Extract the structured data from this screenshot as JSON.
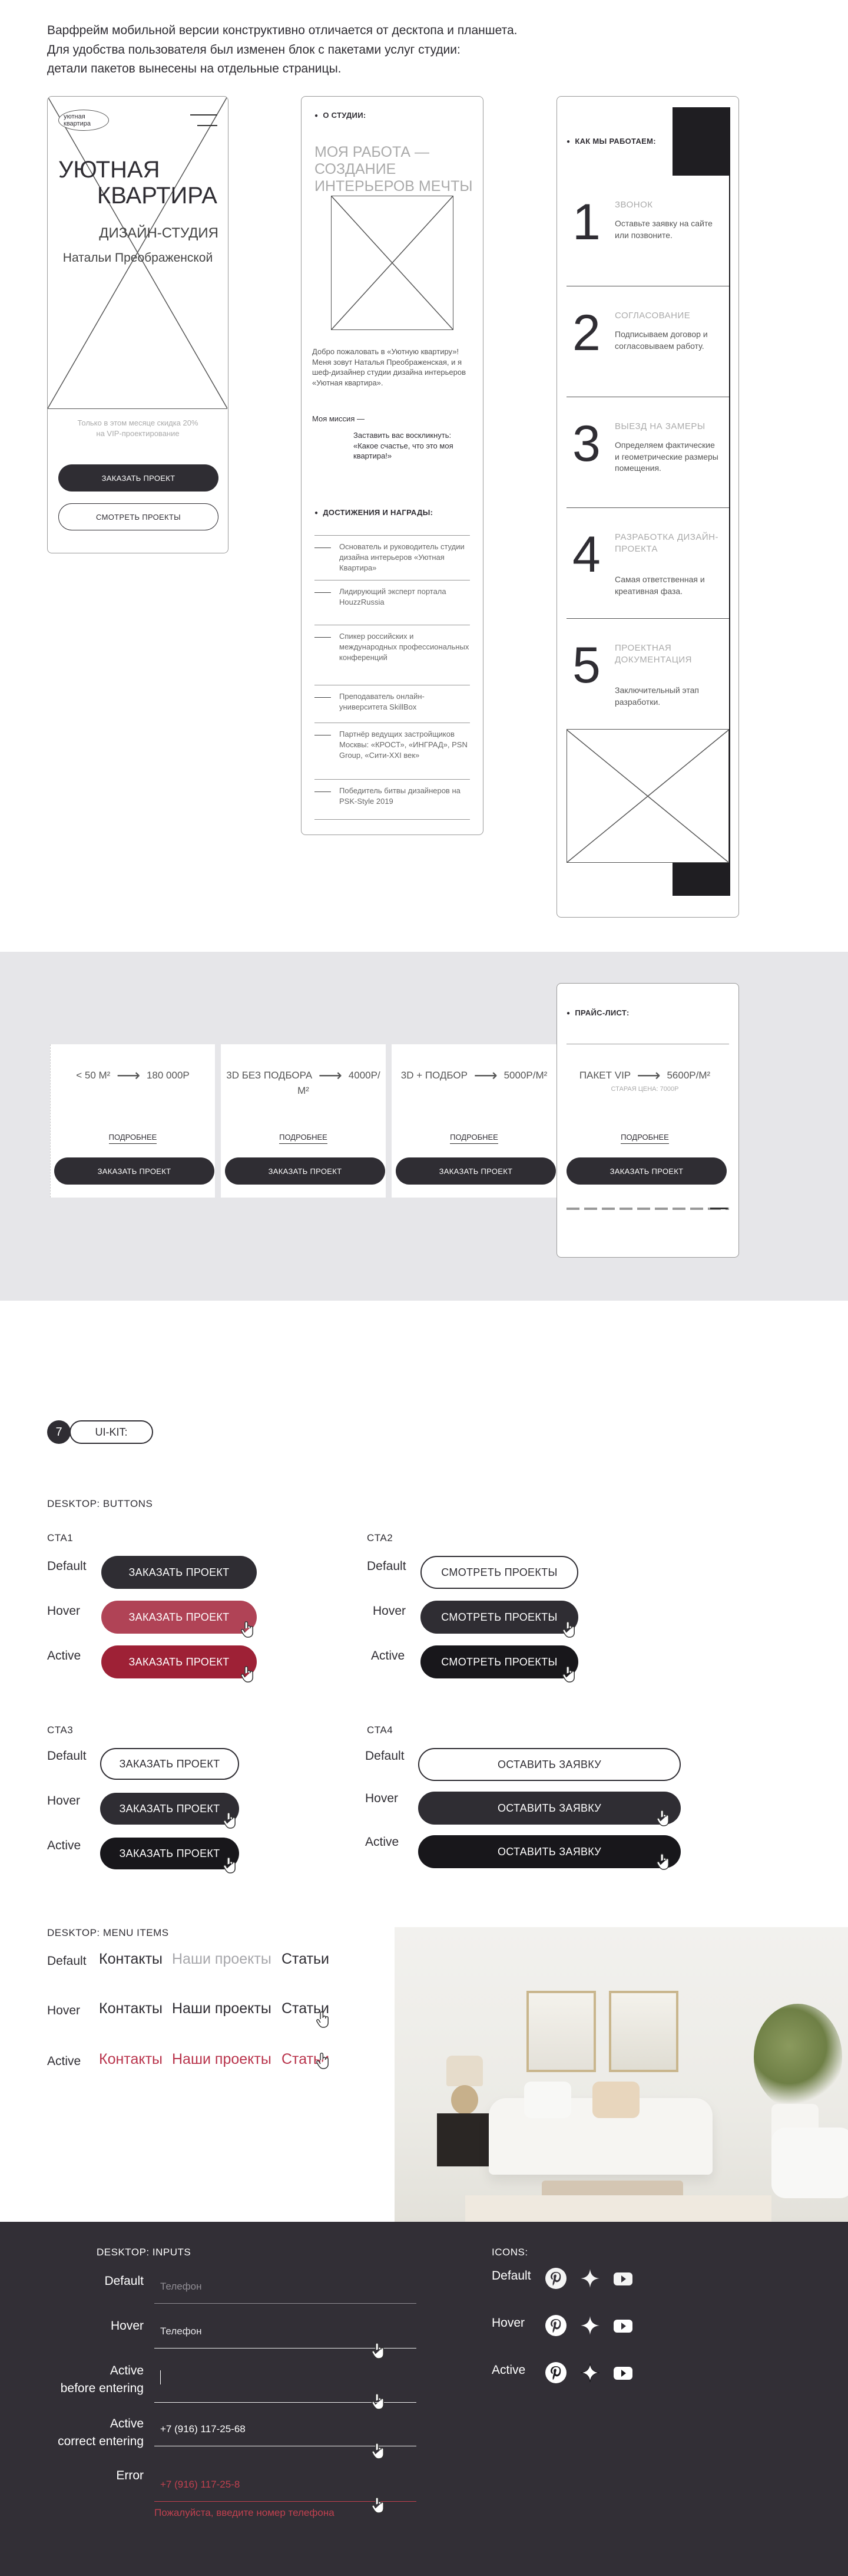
{
  "intro": {
    "line1": "Варфрейм мобильной версии конструктивно отличается от десктопа и планшета.",
    "line2": "Для удобства пользователя был изменен блок с пакетами услуг студии:",
    "line3": "детали пакетов вынесены на отдельные страницы."
  },
  "phone1": {
    "logo_line1": "уютная",
    "logo_line2": "квартира",
    "title_line1": "УЮТНАЯ",
    "title_line2": "КВАРТИРА",
    "sub1": "ДИЗАЙН-СТУДИЯ",
    "sub2": "Натальи Преображенской",
    "promo1": "Только в этом месяце скидка 20%",
    "promo2": "на VIP-проектирование",
    "btn_order": "ЗАКАЗАТЬ ПРОЕКТ",
    "btn_view": "СМОТРЕТЬ ПРОЕКТЫ"
  },
  "phone2": {
    "about_label": "О СТУДИИ:",
    "heading1": "МОЯ РАБОТА —",
    "heading2": "СОЗДАНИЕ",
    "heading3": "ИНТЕРЬЕРОВ МЕЧТЫ",
    "para": "Добро пожаловать в «Уютную квартиру»! Меня зовут Наталья Преображенская, и я шеф-дизайнер студии дизайна интерьеров «Уютная квартира».",
    "mission_label": "Моя миссия —",
    "mission_text": "Заставить вас воскликнуть: «Какое счастье, что это моя квартира!»",
    "awards_label": "ДОСТИЖЕНИЯ И НАГРАДЫ:",
    "awards": [
      "Основатель и руководитель студии дизайна интерьеров «Уютная Квартира»",
      "Лидирующий эксперт портала HouzzRussia",
      "Спикер российских и международных профессиональных конференций",
      "Преподаватель онлайн-университета SkillBox",
      "Партнёр ведущих застройщиков Москвы: «КРОСТ», «ИНГРАД», PSN Group, «Сити-XXI век»",
      "Победитель битвы дизайнеров на PSK-Style 2019"
    ]
  },
  "phone3": {
    "label": "КАК МЫ РАБОТАЕМ:",
    "steps": [
      {
        "num": "1",
        "title": "ЗВОНОК",
        "desc": "Оставьте заявку на сайте или позвоните."
      },
      {
        "num": "2",
        "title": "СОГЛАСОВАНИЕ",
        "desc": "Подписываем договор и согласовываем работу."
      },
      {
        "num": "3",
        "title": "ВЫЕЗД НА ЗАМЕРЫ",
        "desc": "Определяем фактические и геометрические размеры помещения."
      },
      {
        "num": "4",
        "title": "РАЗРАБОТКА ДИЗАЙН-ПРОЕКТА",
        "desc": "Самая ответственная и креативная фаза."
      },
      {
        "num": "5",
        "title": "ПРОЕКТНАЯ ДОКУМЕНТАЦИЯ",
        "desc": "Заключительный этап разработки."
      }
    ]
  },
  "prices": {
    "label": "ПРАЙС-ЛИСТ:",
    "columns": [
      {
        "from": "< 50 М²",
        "to": "180 000Р",
        "more": "ПОДРОБНЕЕ",
        "btn": "ЗАКАЗАТЬ ПРОЕКТ"
      },
      {
        "from": "3D БЕЗ ПОДБОРА",
        "to": "4000Р/М²",
        "more": "ПОДРОБНЕЕ",
        "btn": "ЗАКАЗАТЬ ПРОЕКТ"
      },
      {
        "from": "3D + ПОДБОР",
        "to": "5000Р/М²",
        "more": "ПОДРОБНЕЕ",
        "btn": "ЗАКАЗАТЬ ПРОЕКТ"
      },
      {
        "from": "ПАКЕТ VIP",
        "to": "5600Р/М²",
        "more": "ПОДРОБНЕЕ",
        "btn": "ЗАКАЗАТЬ ПРОЕКТ",
        "old": "СТАРАЯ ЦЕНА: 7000Р"
      }
    ]
  },
  "uikit": {
    "number": "7",
    "label": "UI-KIT:",
    "buttons_title": "DESKTOP: BUTTONS",
    "states": {
      "default": "Default",
      "hover": "Hover",
      "active": "Active"
    },
    "cta1": {
      "name": "CTA1",
      "label": "ЗАКАЗАТЬ ПРОЕКТ"
    },
    "cta2": {
      "name": "CTA2",
      "label": "СМОТРЕТЬ ПРОЕКТЫ"
    },
    "cta3": {
      "name": "CTA3",
      "label": "ЗАКАЗАТЬ ПРОЕКТ"
    },
    "cta4": {
      "name": "CTA4",
      "label": "ОСТАВИТЬ ЗАЯВКУ"
    },
    "menu_title": "DESKTOP: MENU ITEMS",
    "menu": {
      "contacts": "Контакты",
      "projects": "Наши проекты",
      "articles": "Статьи"
    },
    "inputs_title": "DESKTOP: INPUTS",
    "inputs": {
      "default_label": "Default",
      "hover_label": "Hover",
      "active_label1": "Active",
      "active_label2": "before entering",
      "correct_label1": "Active",
      "correct_label2": "correct entering",
      "error_label": "Error",
      "placeholder": "Телефон",
      "correct_value": "+7 (916) 117-25-68",
      "error_value": "+7 (916) 117-25-8",
      "error_msg": "Пожалуйста, введите номер телефона"
    },
    "icons_title": "ICONS:",
    "icon_names": [
      "pinterest-icon",
      "sparkle-icon",
      "youtube-icon"
    ]
  },
  "colors": {
    "dark": "#2f2d33",
    "black": "#18171b",
    "accent_hover": "#b04356",
    "accent_active": "#9e2136",
    "grey_band": "#e6e6e9"
  }
}
